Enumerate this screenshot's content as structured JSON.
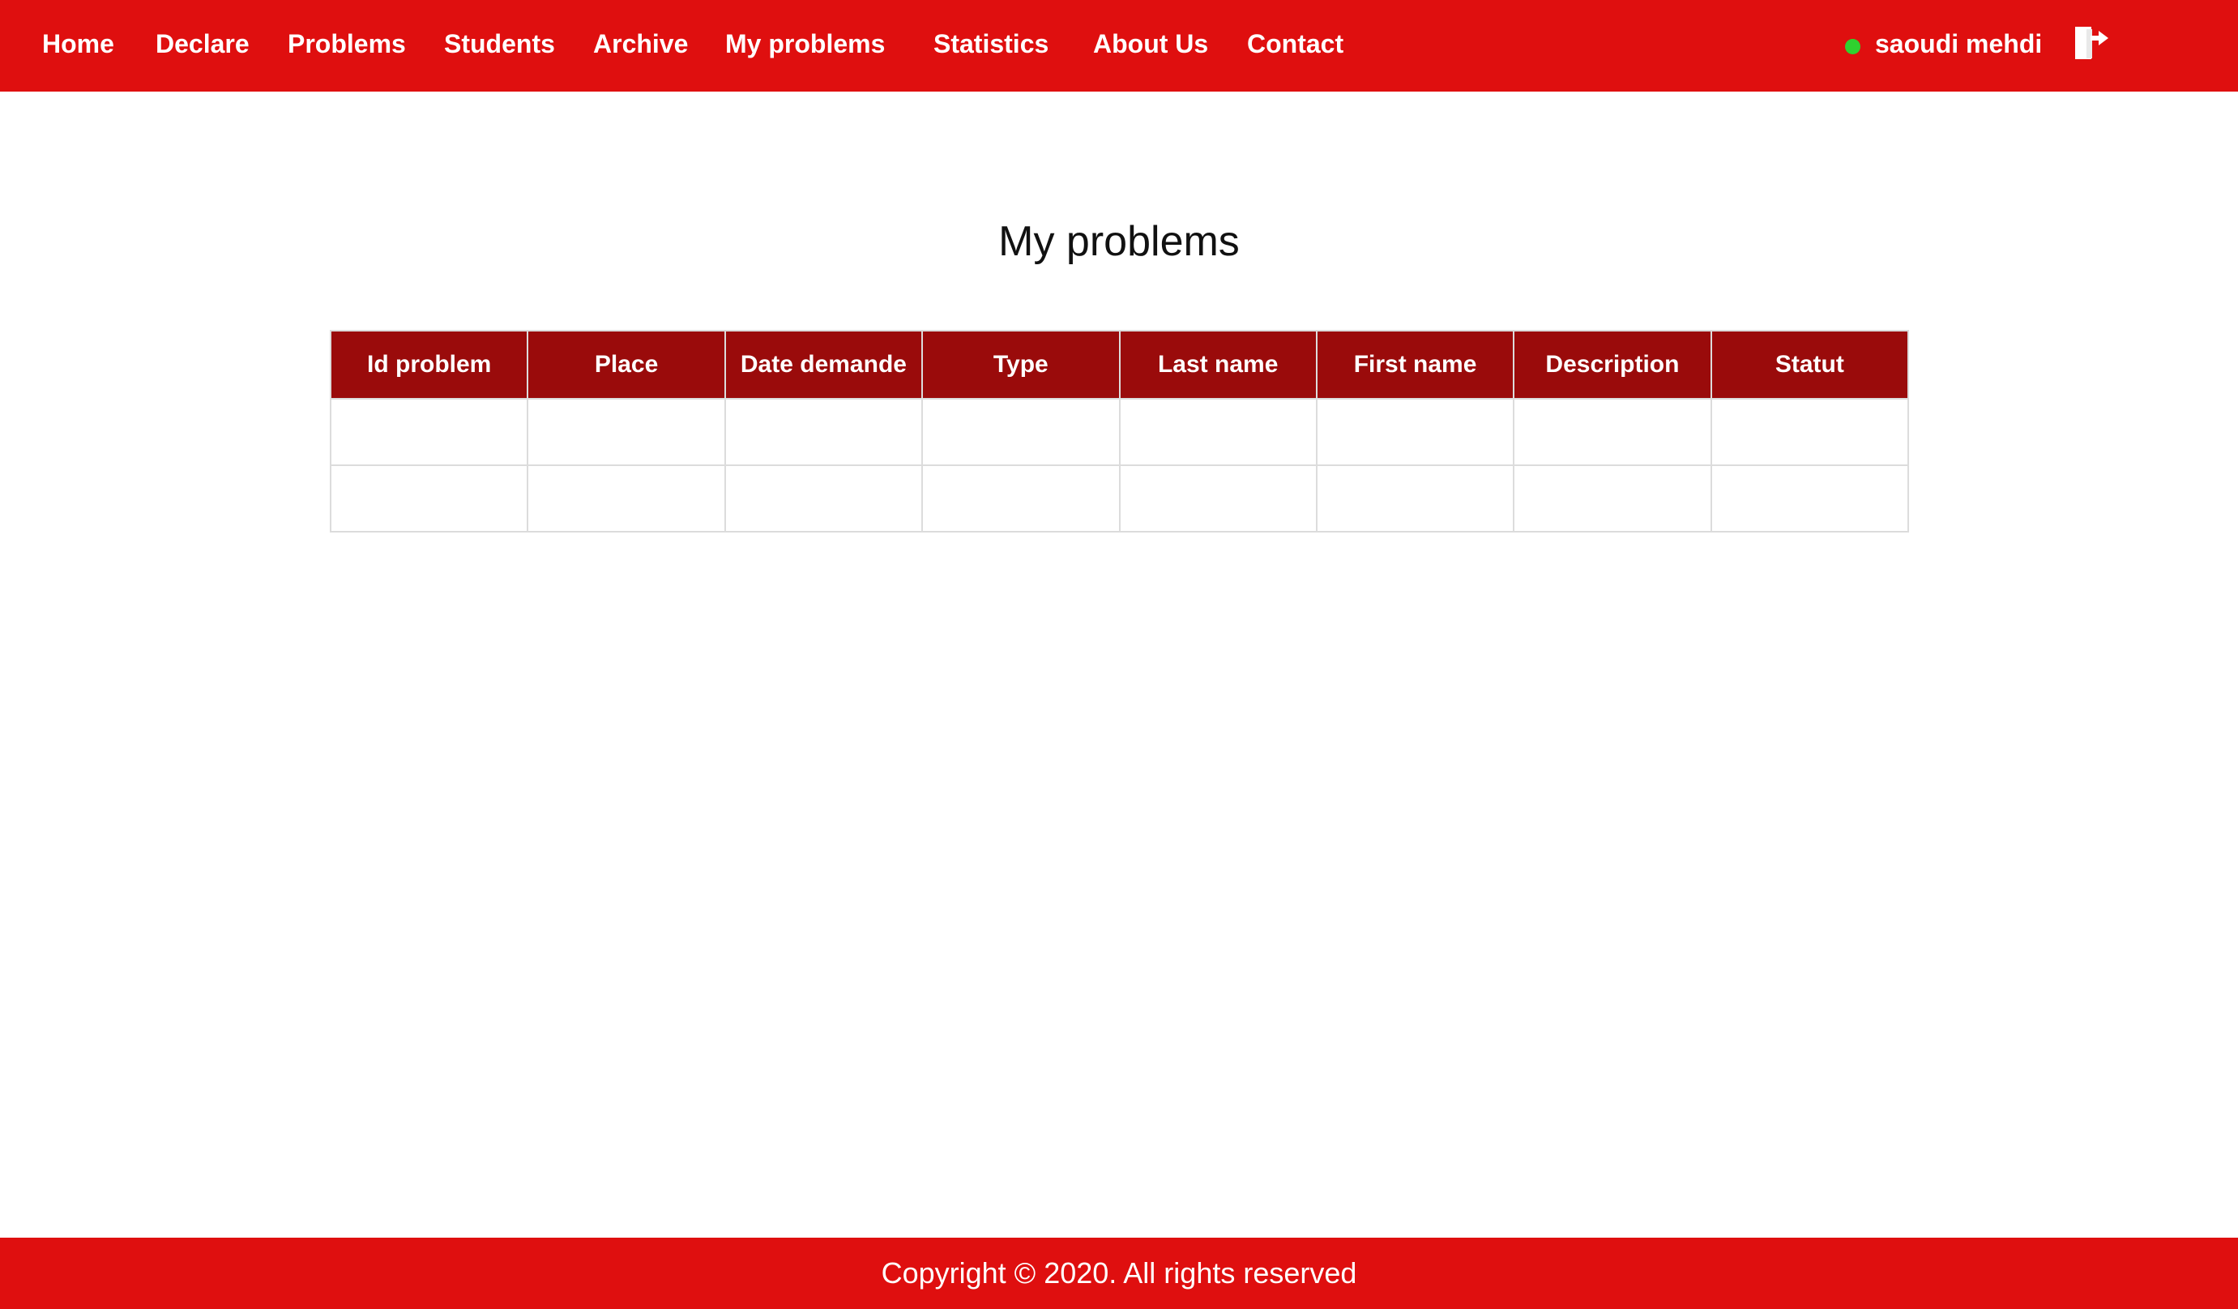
{
  "nav": {
    "items": [
      {
        "id": "home",
        "label": "Home"
      },
      {
        "id": "declare",
        "label": "Declare"
      },
      {
        "id": "problems",
        "label": "Problems"
      },
      {
        "id": "students",
        "label": "Students"
      },
      {
        "id": "archive",
        "label": "Archive"
      },
      {
        "id": "my-problems",
        "label": "My problems"
      },
      {
        "id": "statistics",
        "label": "Statistics"
      },
      {
        "id": "about-us",
        "label": "About Us"
      },
      {
        "id": "contact",
        "label": "Contact"
      }
    ],
    "user": {
      "name": "saoudi mehdi",
      "status_color": "#2fd12f"
    },
    "logout_icon": "logout-icon"
  },
  "main": {
    "title": "My problems",
    "table": {
      "columns": [
        "Id problem",
        "Place",
        "Date demande",
        "Type",
        "Last name",
        "First name",
        "Description",
        "Statut"
      ],
      "rows": [
        [
          "",
          "",
          "",
          "",
          "",
          "",
          "",
          ""
        ],
        [
          "",
          "",
          "",
          "",
          "",
          "",
          "",
          ""
        ]
      ]
    }
  },
  "footer": {
    "text": "Copyright © 2020. All rights reserved"
  },
  "colors": {
    "navbar": "#df0f0f",
    "table_header": "#9a0b0b",
    "footer": "#df0f0f"
  }
}
